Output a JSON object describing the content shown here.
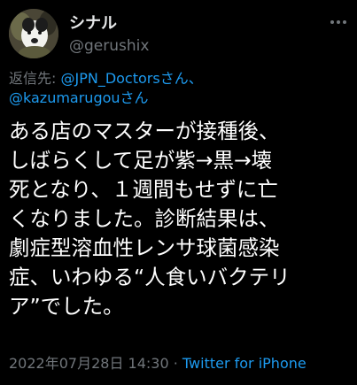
{
  "user": {
    "display_name": "シナル",
    "handle": "@gerushix",
    "avatar_icon": "dog-avatar-icon"
  },
  "reply": {
    "prefix": "返信先: ",
    "mention_1": "@JPN_Doctorsさん、",
    "mention_2": "@kazumarugouさん"
  },
  "tweet": {
    "lines": [
      "ある店のマスターが接種後、",
      "しばらくして足が紫→黒→壊",
      "死となり、１週間もせずに亡",
      "くなりました。診断結果は、",
      "劇症型溶血性レンサ球菌感染",
      "症、いわゆる“人食いバクテリ",
      "ア”でした。"
    ]
  },
  "meta": {
    "timestamp": "2022年07月28日 14:30",
    "separator": " · ",
    "source": "Twitter for iPhone"
  },
  "colors": {
    "background": "#000000",
    "text": "#ffffff",
    "secondary": "#71767b",
    "link": "#1d9bf0"
  }
}
